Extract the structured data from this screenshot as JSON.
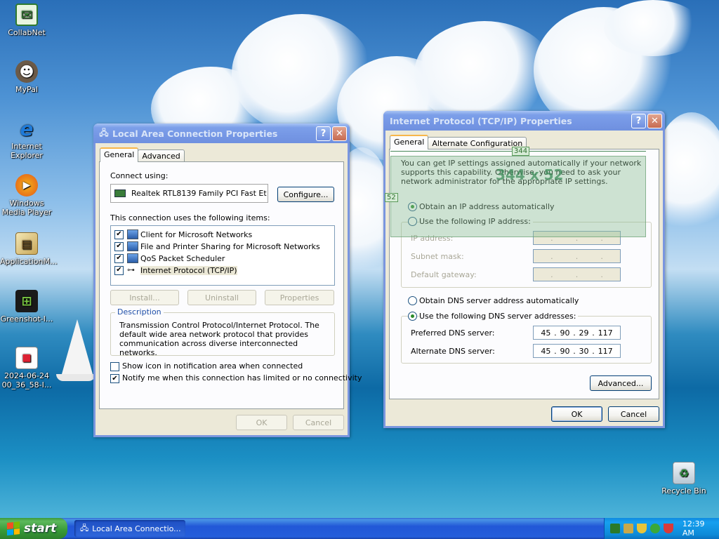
{
  "desktop": {
    "icons": [
      {
        "label": "CollabNet",
        "icon": "collabnet-icon"
      },
      {
        "label": "MyPal",
        "icon": "mypal-icon"
      },
      {
        "label": "Internet Explorer",
        "icon": "internet-explorer-icon"
      },
      {
        "label": "Windows Media Player",
        "icon": "windows-media-player-icon"
      },
      {
        "label": "ApplicationM...",
        "icon": "application-icon"
      },
      {
        "label": "Greenshot-I...",
        "icon": "greenshot-icon"
      },
      {
        "label": "2024-06-24 00_36_58-I...",
        "icon": "image-file-icon"
      },
      {
        "label": "Recycle Bin",
        "icon": "recycle-bin-icon"
      }
    ]
  },
  "lac": {
    "title": "Local Area Connection Properties",
    "tabs": [
      "General",
      "Advanced"
    ],
    "connect_using_label": "Connect using:",
    "adapter": "Realtek RTL8139 Family PCI Fast Et",
    "configure": "Configure...",
    "items_label": "This connection uses the following items:",
    "items": [
      {
        "label": "Client for Microsoft Networks",
        "checked": true
      },
      {
        "label": "File and Printer Sharing for Microsoft Networks",
        "checked": true
      },
      {
        "label": "QoS Packet Scheduler",
        "checked": true
      },
      {
        "label": "Internet Protocol (TCP/IP)",
        "checked": true
      }
    ],
    "install": "Install...",
    "uninstall": "Uninstall",
    "properties": "Properties",
    "description_legend": "Description",
    "description": "Transmission Control Protocol/Internet Protocol. The default wide area network protocol that provides communication across diverse interconnected networks.",
    "show_icon": "Show icon in notification area when connected",
    "notify": "Notify me when this connection has limited or no connectivity",
    "ok": "OK",
    "cancel": "Cancel"
  },
  "tcp": {
    "title": "Internet Protocol (TCP/IP) Properties",
    "tabs": [
      "General",
      "Alternate Configuration"
    ],
    "intro": "You can get IP settings assigned automatically if your network supports this capability. Otherwise, you need to ask your network administrator for the appropriate IP settings.",
    "obtain_ip": "Obtain an IP address automatically",
    "use_ip": "Use the following IP address:",
    "ip_address_label": "IP address:",
    "subnet_label": "Subnet mask:",
    "gateway_label": "Default gateway:",
    "obtain_dns": "Obtain DNS server address automatically",
    "use_dns": "Use the following DNS server addresses:",
    "preferred_label": "Preferred DNS server:",
    "preferred": [
      "45",
      "90",
      "29",
      "117"
    ],
    "alternate_label": "Alternate DNS server:",
    "alternate": [
      "45",
      "90",
      "30",
      "117"
    ],
    "advanced": "Advanced...",
    "ok": "OK",
    "cancel": "Cancel"
  },
  "overlay": {
    "width_label": "344",
    "height_label": "52",
    "size_text": "344 x 52"
  },
  "taskbar": {
    "start": "start",
    "task": "Local Area Connectio...",
    "clock": "12:39 AM"
  }
}
